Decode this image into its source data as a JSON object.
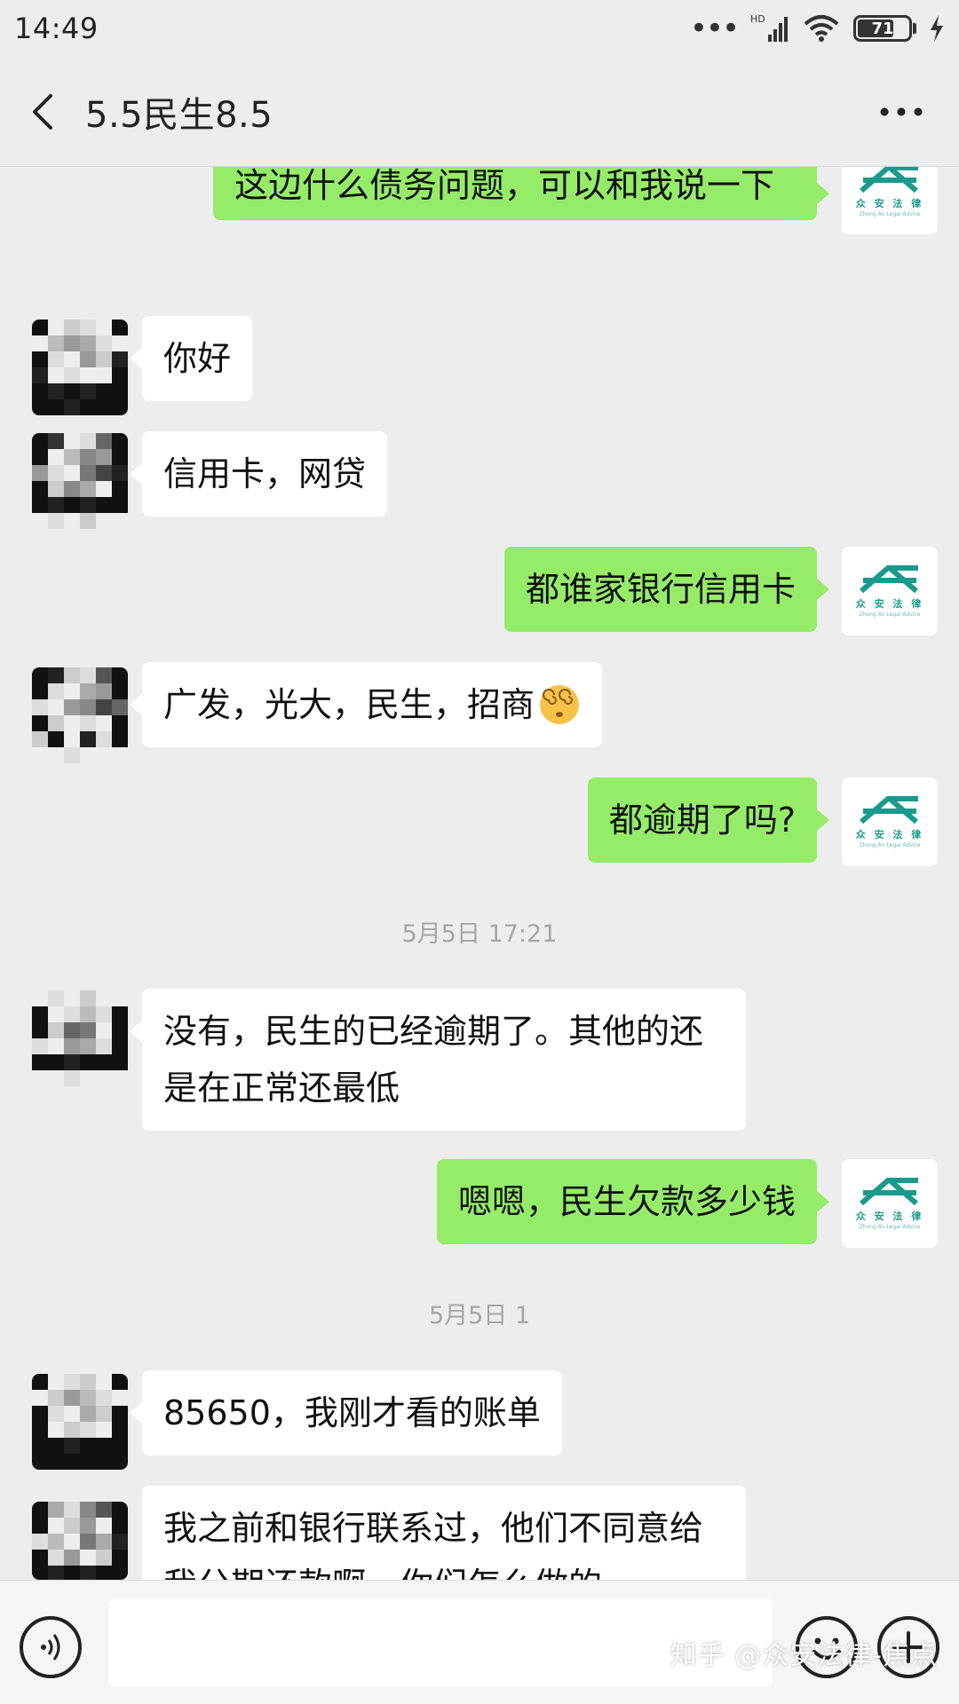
{
  "status_bar": {
    "time": "14:49",
    "hd_label": "HD",
    "battery_level": "71"
  },
  "header": {
    "title": "5.5民生8.5"
  },
  "messages": [
    {
      "side": "out",
      "text": "这边什么债务问题，可以和我说一下"
    },
    {
      "side": "in",
      "text": "你好"
    },
    {
      "side": "in",
      "text": "信用卡，网贷"
    },
    {
      "side": "out",
      "text": "都谁家银行信用卡"
    },
    {
      "side": "in",
      "text": "广发，光大，民生，招商"
    },
    {
      "side": "out",
      "text": "都逾期了吗?"
    },
    {
      "side": "in",
      "text": "没有，民生的已经逾期了。其他的还是在正常还最低"
    },
    {
      "side": "out",
      "text": "嗯嗯，民生欠款多少钱"
    },
    {
      "side": "in",
      "text": "85650，我刚才看的账单"
    },
    {
      "side": "in",
      "text": "我之前和银行联系过，他们不同意给我分期还款啊，你们怎么做的"
    }
  ],
  "timestamps": [
    "5月5日 17:21",
    "5月5日 1"
  ],
  "emoji": "dizzy-face",
  "avatar": {
    "logo_text": "众 安 法 律",
    "logo_sub": "Zhong An Legal Advice"
  },
  "input_bar": {
    "voice_icon": "voice-icon",
    "emoji_icon": "emoji-icon",
    "plus_icon": "plus-icon"
  },
  "watermark": "知乎 @众安法律-焦点",
  "colors": {
    "background": "#ededed",
    "out_bubble": "#95ec69",
    "in_bubble": "#ffffff",
    "logo": "#1a9a8c"
  }
}
